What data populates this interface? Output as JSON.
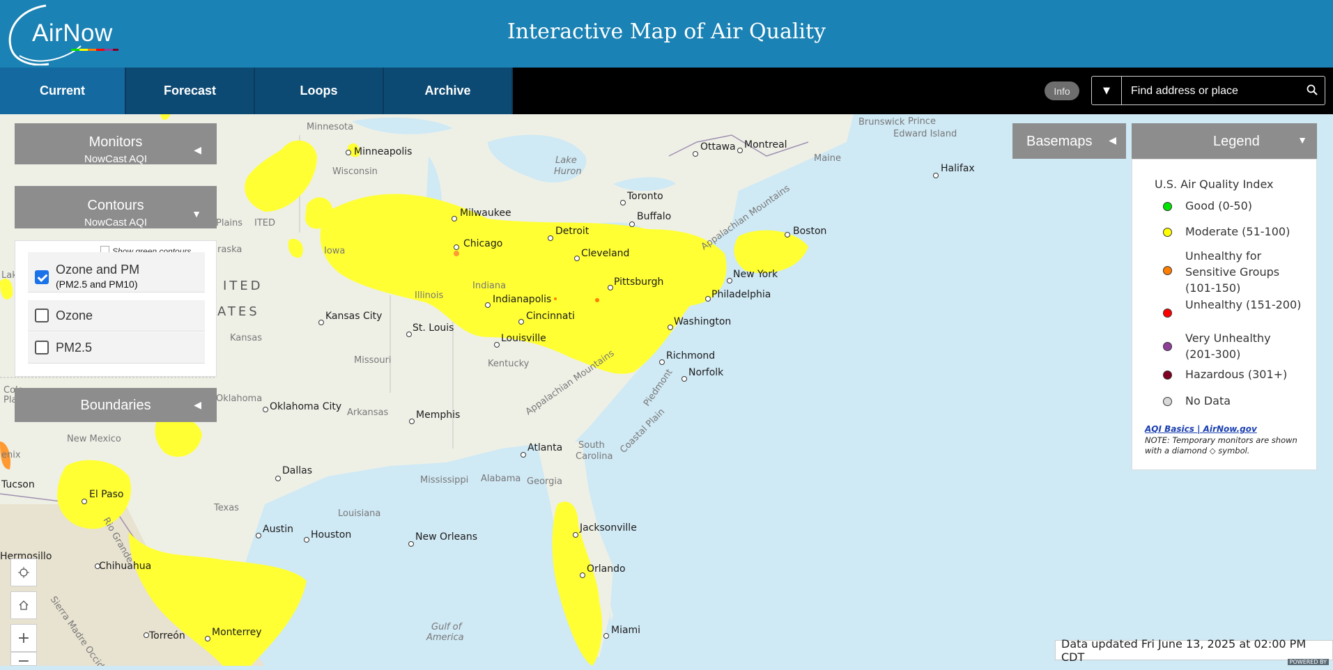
{
  "header": {
    "logo_text": "AirNow",
    "title": "Interactive Map of Air Quality"
  },
  "nav": {
    "tabs": [
      {
        "label": "Current"
      },
      {
        "label": "Forecast"
      },
      {
        "label": "Loops"
      },
      {
        "label": "Archive"
      }
    ],
    "info_label": "Info",
    "search_placeholder": "Find address or place"
  },
  "monitors": {
    "title": "Monitors",
    "subtitle": "NowCast AQI"
  },
  "contours": {
    "title": "Contours",
    "subtitle": "NowCast AQI",
    "show_green": "Show green contours",
    "options": [
      {
        "label": "Ozone and PM",
        "sub": "(PM2.5 and PM10)",
        "checked": true
      },
      {
        "label": "Ozone",
        "checked": false
      },
      {
        "label": "PM2.5",
        "checked": false
      }
    ]
  },
  "boundaries": {
    "title": "Boundaries"
  },
  "basemaps": {
    "title": "Basemaps"
  },
  "legend": {
    "title": "Legend",
    "index_title": "U.S. Air Quality Index",
    "items": [
      {
        "label": "Good (0-50)",
        "color": "#00e400"
      },
      {
        "label": "Moderate (51-100)",
        "color": "#ffff00"
      },
      {
        "label": "Unhealthy for Sensitive Groups (101-150)",
        "color": "#ff7e00"
      },
      {
        "label": "Unhealthy (151-200)",
        "color": "#ff0000"
      },
      {
        "label": "Very Unhealthy (201-300)",
        "color": "#8f3f97"
      },
      {
        "label": "Hazardous (301+)",
        "color": "#7e0023"
      },
      {
        "label": "No Data",
        "color": "#d9d9d9"
      }
    ],
    "link": "AQI Basics | AirNow.gov",
    "note": "NOTE: Temporary monitors are shown with a diamond ◇ symbol."
  },
  "map": {
    "cities": [
      "Minneapolis",
      "Milwaukee",
      "Chicago",
      "Detroit",
      "Toronto",
      "Buffalo",
      "Ottawa",
      "Montreal",
      "Boston",
      "Halifax",
      "Cleveland",
      "Pittsburgh",
      "New York",
      "Philadelphia",
      "Washington",
      "Indianapolis",
      "Cincinnati",
      "Louisville",
      "St. Louis",
      "Kansas City",
      "Richmond",
      "Norfolk",
      "Memphis",
      "Oklahoma City",
      "Atlanta",
      "Dallas",
      "Tucson",
      "El Paso",
      "Austin",
      "Houston",
      "New Orleans",
      "Jacksonville",
      "Orlando",
      "Miami",
      "Hermosillo",
      "Chihuahua",
      "Torreón",
      "Monterrey"
    ],
    "regions": [
      "Minnesota",
      "Wisconsin",
      "Iowa",
      "Illinois",
      "Indiana",
      "Missouri",
      "Kentucky",
      "Kansas",
      "Oklahoma",
      "Arkansas",
      "Mississippi",
      "Alabama",
      "Georgia",
      "South Carolina",
      "Texas",
      "Louisiana",
      "New Mexico",
      "Maine",
      "New Brunswick",
      "Prince Edward Island",
      "Lake Huron",
      "Gulf of America",
      "Appalachian Mountains",
      "Piedmont",
      "Coastal Plain",
      "Sierra Madre Occidental",
      "Rio Grande",
      "Great Plains",
      "UNITED",
      "STATES",
      "Nebraska"
    ]
  },
  "status": {
    "updated": "Data updated Fri June 13, 2025 at 02:00 PM CDT",
    "powered": "POWERED BY"
  }
}
